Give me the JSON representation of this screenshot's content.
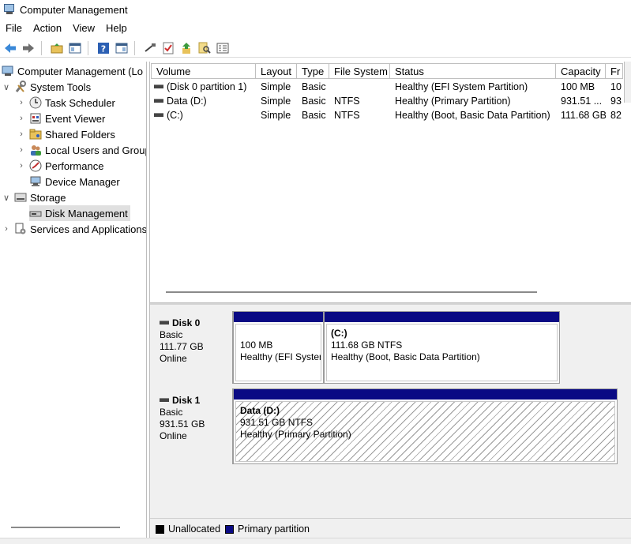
{
  "window": {
    "title": "Computer Management"
  },
  "menu": [
    "File",
    "Action",
    "View",
    "Help"
  ],
  "toolbar": {
    "buttons": [
      "back-icon",
      "forward-icon",
      "up-folder-icon",
      "show-hide-tree-icon",
      "help-icon",
      "show-hide-action-icon",
      "connect-icon",
      "check-icon",
      "import-icon",
      "search-icon",
      "properties-icon"
    ]
  },
  "tree": {
    "root": "Computer Management (Lo",
    "system_tools": "System Tools",
    "task_scheduler": "Task Scheduler",
    "event_viewer": "Event Viewer",
    "shared_folders": "Shared Folders",
    "local_users": "Local Users and Group",
    "performance": "Performance",
    "device_manager": "Device Manager",
    "storage": "Storage",
    "disk_management": "Disk Management",
    "services": "Services and Applications"
  },
  "volume_list": {
    "columns": [
      "Volume",
      "Layout",
      "Type",
      "File System",
      "Status",
      "Capacity",
      "Fr"
    ],
    "rows": [
      {
        "volume": "(Disk 0 partition 1)",
        "layout": "Simple",
        "type": "Basic",
        "fs": "",
        "status": "Healthy (EFI System Partition)",
        "capacity": "100 MB",
        "free": "10"
      },
      {
        "volume": "Data (D:)",
        "layout": "Simple",
        "type": "Basic",
        "fs": "NTFS",
        "status": "Healthy (Primary Partition)",
        "capacity": "931.51 ...",
        "free": "93"
      },
      {
        "volume": "(C:)",
        "layout": "Simple",
        "type": "Basic",
        "fs": "NTFS",
        "status": "Healthy (Boot, Basic Data Partition)",
        "capacity": "111.68 GB",
        "free": "82"
      }
    ]
  },
  "disks": [
    {
      "name": "Disk 0",
      "type": "Basic",
      "size": "111.77 GB",
      "state": "Online",
      "partitions": [
        {
          "name": "",
          "size": "100 MB",
          "status": "Healthy (EFI System Partition)"
        },
        {
          "name": "(C:)",
          "size": "111.68 GB NTFS",
          "status": "Healthy (Boot, Basic Data Partition)"
        }
      ]
    },
    {
      "name": "Disk 1",
      "type": "Basic",
      "size": "931.51 GB",
      "state": "Online",
      "partitions": [
        {
          "name": "Data  (D:)",
          "size": "931.51 GB NTFS",
          "status": "Healthy (Primary Partition)"
        }
      ]
    }
  ],
  "legend": {
    "unallocated": "Unallocated",
    "primary": "Primary partition",
    "colors": {
      "unallocated": "#000000",
      "primary": "#0a0a84"
    }
  }
}
